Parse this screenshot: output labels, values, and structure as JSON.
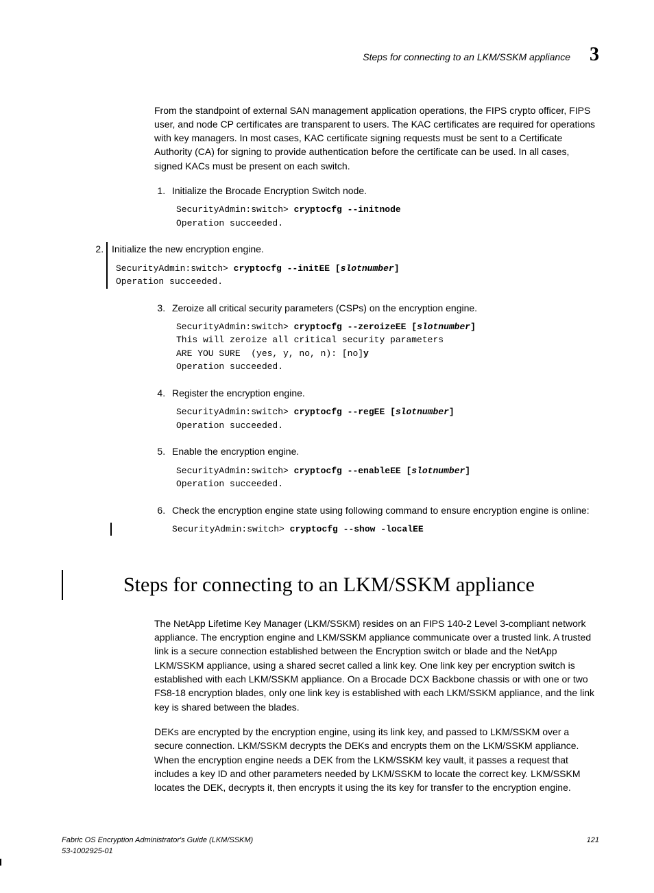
{
  "header": {
    "title": "Steps for connecting to an LKM/SSKM appliance",
    "chapter": "3"
  },
  "intro": "From the standpoint of external SAN management application operations, the FIPS crypto officer, FIPS user, and node CP certificates are transparent to users. The KAC certificates are required for operations with key managers. In most cases, KAC certificate signing requests must be sent to a Certificate Authority (CA) for signing to provide authentication before the certificate can be used. In all cases, signed KACs must be present on each switch.",
  "steps": {
    "s1": "Initialize the Brocade Encryption Switch node.",
    "c1_prompt": "SecurityAdmin:switch> ",
    "c1_cmd": "cryptocfg --initnode",
    "c1_out": "Operation succeeded.",
    "s2": "Initialize the new encryption engine.",
    "c2_prompt": "SecurityAdmin:switch> ",
    "c2_cmd": "cryptocfg --initEE [",
    "c2_arg": "slotnumber",
    "c2_close": "]",
    "c2_out": "Operation succeeded.",
    "s3": "Zeroize all critical security parameters (CSPs) on the encryption engine.",
    "c3_prompt": "SecurityAdmin:switch> ",
    "c3_cmd": "cryptocfg --zeroizeEE [",
    "c3_arg": "slotnumber",
    "c3_close": "]",
    "c3_out1": "This will zeroize all critical security parameters",
    "c3_out2": "ARE YOU SURE  (yes, y, no, n): [no]",
    "c3_resp": "y",
    "c3_out3": "Operation succeeded.",
    "s4": "Register the encryption engine.",
    "c4_prompt": "SecurityAdmin:switch> ",
    "c4_cmd": "cryptocfg --regEE [",
    "c4_arg": "slotnumber",
    "c4_close": "]",
    "c4_out": "Operation succeeded.",
    "s5": "Enable the encryption engine.",
    "c5_prompt": "SecurityAdmin:switch> ",
    "c5_cmd": "cryptocfg --enableEE [",
    "c5_arg": "slotnumber",
    "c5_close": "]",
    "c5_out": "Operation succeeded.",
    "s6": "Check the encryption engine state using following command to ensure encryption engine is online:",
    "c6_prompt": "SecurityAdmin:switch> ",
    "c6_cmd": "cryptocfg --show -localEE"
  },
  "section": {
    "title": "Steps for connecting to an LKM/SSKM appliance",
    "p1": "The NetApp Lifetime Key Manager (LKM/SSKM) resides on an FIPS 140-2 Level 3-compliant network appliance. The encryption engine and LKM/SSKM appliance communicate over a trusted link. A trusted link is a secure connection established between the Encryption switch or blade and the NetApp LKM/SSKM appliance, using a shared secret called a link key. One link key per encryption switch is established with each LKM/SSKM appliance. On a Brocade DCX Backbone chassis or with one or two FS8-18 encryption blades, only one link key is established with each LKM/SSKM appliance, and the link key is shared between the blades.",
    "p2": "DEKs are encrypted by the encryption engine, using its link key, and passed to LKM/SSKM over a secure connection. LKM/SSKM decrypts the DEKs and encrypts them on the LKM/SSKM appliance. When the encryption engine needs a DEK from the LKM/SSKM key vault, it passes a request that includes a key ID and other parameters needed by LKM/SSKM to locate the correct key. LKM/SSKM locates the DEK, decrypts it, then encrypts it using the its key for transfer to the encryption engine."
  },
  "footer": {
    "left1": "Fabric OS Encryption Administrator's Guide  (LKM/SSKM)",
    "left2": "53-1002925-01",
    "right": "121"
  }
}
